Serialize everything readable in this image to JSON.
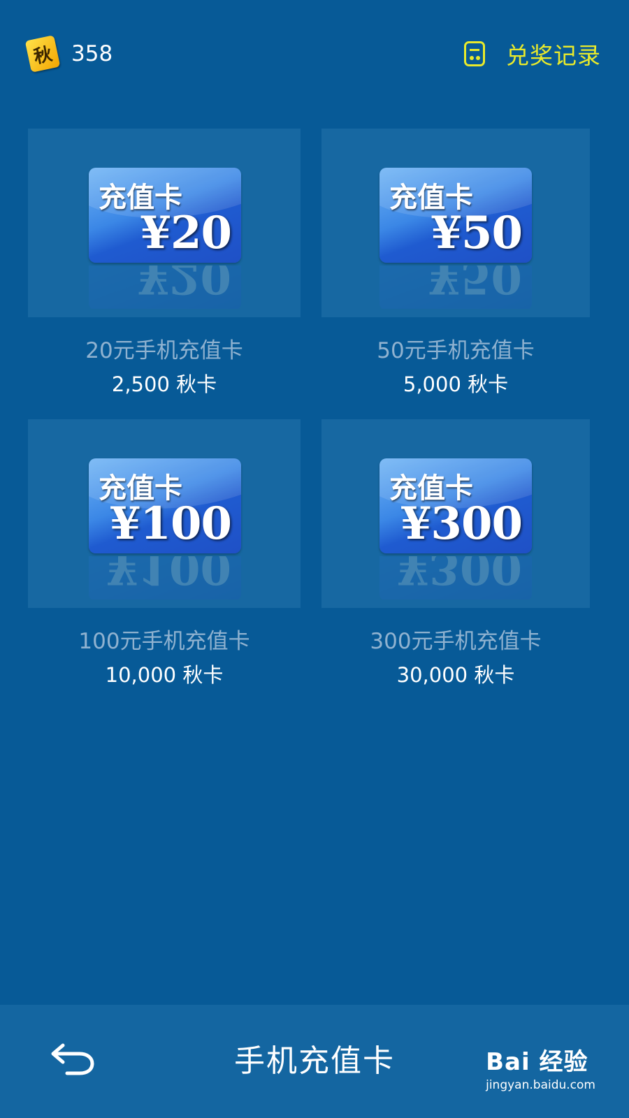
{
  "header": {
    "coin_icon_glyph": "秋",
    "coin_count": "358",
    "records_label": "兑奖记录",
    "accent": "#e9ea2b"
  },
  "cards": [
    {
      "card_title": "充值卡",
      "amount": "¥20",
      "name": "20元手机充值卡",
      "price": "2,500 秋卡"
    },
    {
      "card_title": "充值卡",
      "amount": "¥50",
      "name": "50元手机充值卡",
      "price": "5,000 秋卡"
    },
    {
      "card_title": "充值卡",
      "amount": "¥100",
      "name": "100元手机充值卡",
      "price": "10,000 秋卡"
    },
    {
      "card_title": "充值卡",
      "amount": "¥300",
      "name": "300元手机充值卡",
      "price": "30,000 秋卡"
    }
  ],
  "footer": {
    "back_icon": "back-arrow-icon",
    "title": "手机充值卡",
    "watermark_main": "Bai 经验",
    "watermark_sub": "jingyan.baidu.com"
  },
  "colors": {
    "background": "#075a97",
    "card_tile": "#1768a2",
    "footer": "#1466a1"
  }
}
